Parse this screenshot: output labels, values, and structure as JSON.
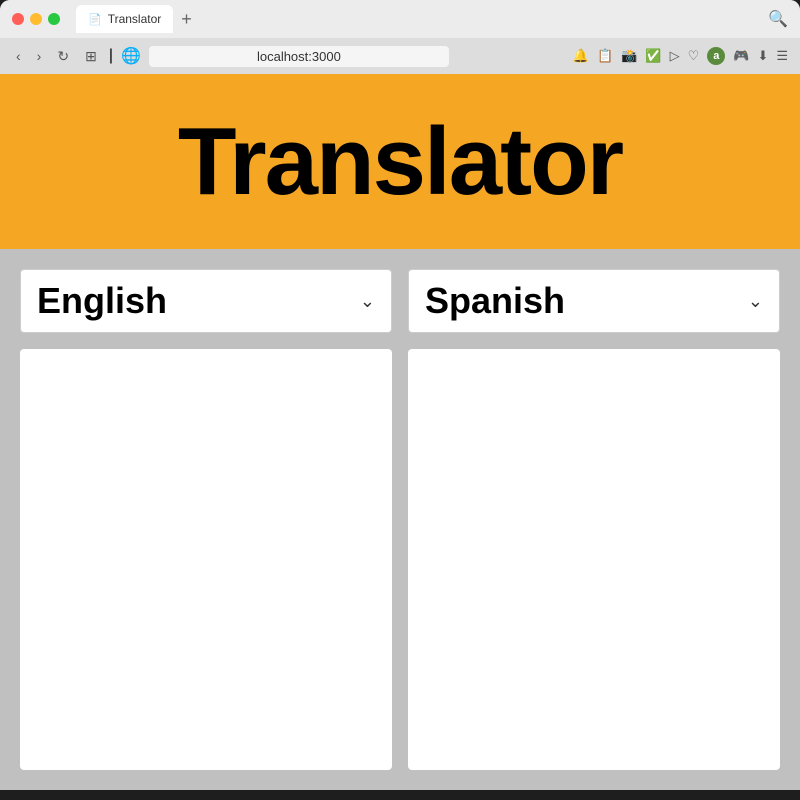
{
  "browser": {
    "tab_title": "Translator",
    "tab_icon": "📄",
    "new_tab_label": "+",
    "url": "localhost:3000",
    "nav": {
      "back": "‹",
      "forward": "›",
      "reload": "↻",
      "grid": "⊞",
      "separator": "|",
      "globe": "🌐"
    },
    "nav_icons": [
      "🔔",
      "📋",
      "📷",
      "✔",
      "▷",
      "♡",
      "a",
      "🎮",
      "⬇",
      "☰"
    ]
  },
  "app": {
    "title": "Translator",
    "header_color": "#f5a623",
    "left_panel": {
      "language_label": "English",
      "dropdown_arrow": "⌄",
      "textarea_placeholder": "",
      "textarea_value": ""
    },
    "right_panel": {
      "language_label": "Spanish",
      "dropdown_arrow": "⌄",
      "textarea_placeholder": "",
      "textarea_value": ""
    }
  }
}
